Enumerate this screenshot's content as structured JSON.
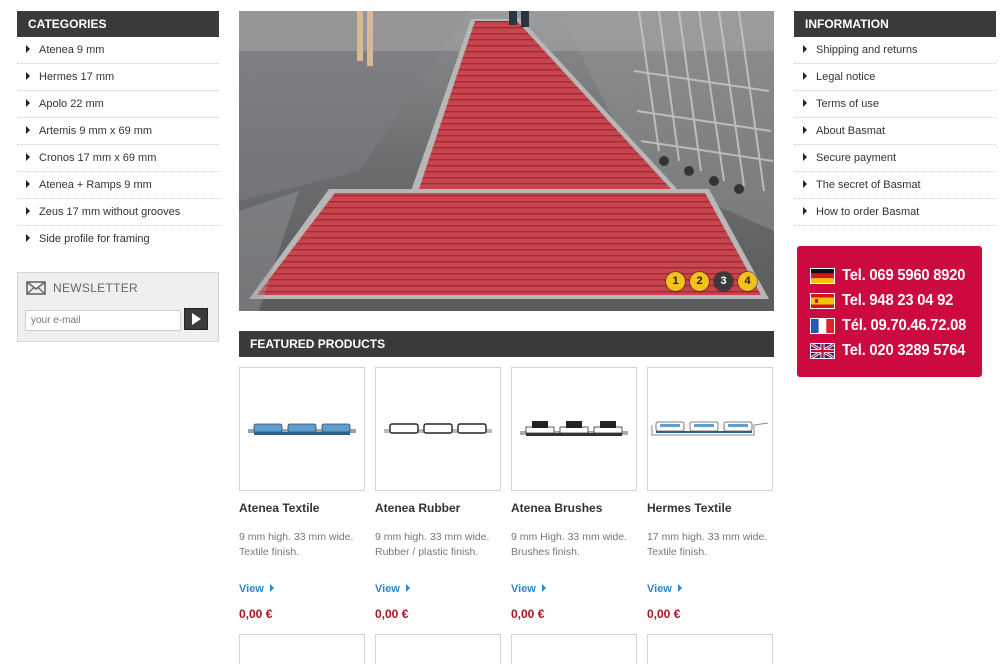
{
  "categories": {
    "title": "CATEGORIES",
    "items": [
      {
        "label": "Atenea 9 mm"
      },
      {
        "label": "Hermes 17 mm"
      },
      {
        "label": "Apolo 22 mm"
      },
      {
        "label": "Artemis 9 mm x 69 mm"
      },
      {
        "label": "Cronos 17 mm x 69 mm"
      },
      {
        "label": "Atenea + Ramps 9 mm"
      },
      {
        "label": "Zeus 17 mm without grooves"
      },
      {
        "label": "Side profile for framing"
      }
    ]
  },
  "newsletter": {
    "title": "NEWSLETTER",
    "placeholder": "your e-mail"
  },
  "slider": {
    "dots": [
      "1",
      "2",
      "3",
      "4"
    ],
    "active_index": 2
  },
  "featured": {
    "title": "FEATURED PRODUCTS",
    "products": [
      {
        "name": "Atenea Textile",
        "desc": "9 mm high. 33 mm wide. Textile finish.",
        "view": "View",
        "price": "0,00 €"
      },
      {
        "name": "Atenea Rubber",
        "desc": "9 mm high. 33 mm wide. Rubber / plastic finish.",
        "view": "View",
        "price": "0,00 €"
      },
      {
        "name": "Atenea Brushes",
        "desc": "9 mm High. 33 mm wide. Brushes finish.",
        "view": "View",
        "price": "0,00 €"
      },
      {
        "name": "Hermes Textile",
        "desc": "17 mm high. 33 mm wide. Textile finish.",
        "view": "View",
        "price": "0,00 €"
      }
    ]
  },
  "information": {
    "title": "INFORMATION",
    "items": [
      {
        "label": "Shipping and returns"
      },
      {
        "label": "Legal notice"
      },
      {
        "label": "Terms of use"
      },
      {
        "label": "About Basmat"
      },
      {
        "label": "Secure payment"
      },
      {
        "label": "The secret of Basmat"
      },
      {
        "label": "How to order Basmat"
      }
    ]
  },
  "phones": [
    {
      "flag": "germany-flag-icon",
      "number": "Tel. 069 5960 8920"
    },
    {
      "flag": "spain-flag-icon",
      "number": "Tel. 948 23 04 92"
    },
    {
      "flag": "france-flag-icon",
      "number": "Tél. 09.70.46.72.08"
    },
    {
      "flag": "uk-flag-icon",
      "number": "Tel. 020 3289 5764"
    }
  ],
  "colors": {
    "header_bg": "#3a3a3a",
    "phone_box_bg": "#cc0a3f",
    "link_blue": "#2a89c6",
    "price_red": "#a8141d",
    "slider_dot": "#f3c21a"
  }
}
